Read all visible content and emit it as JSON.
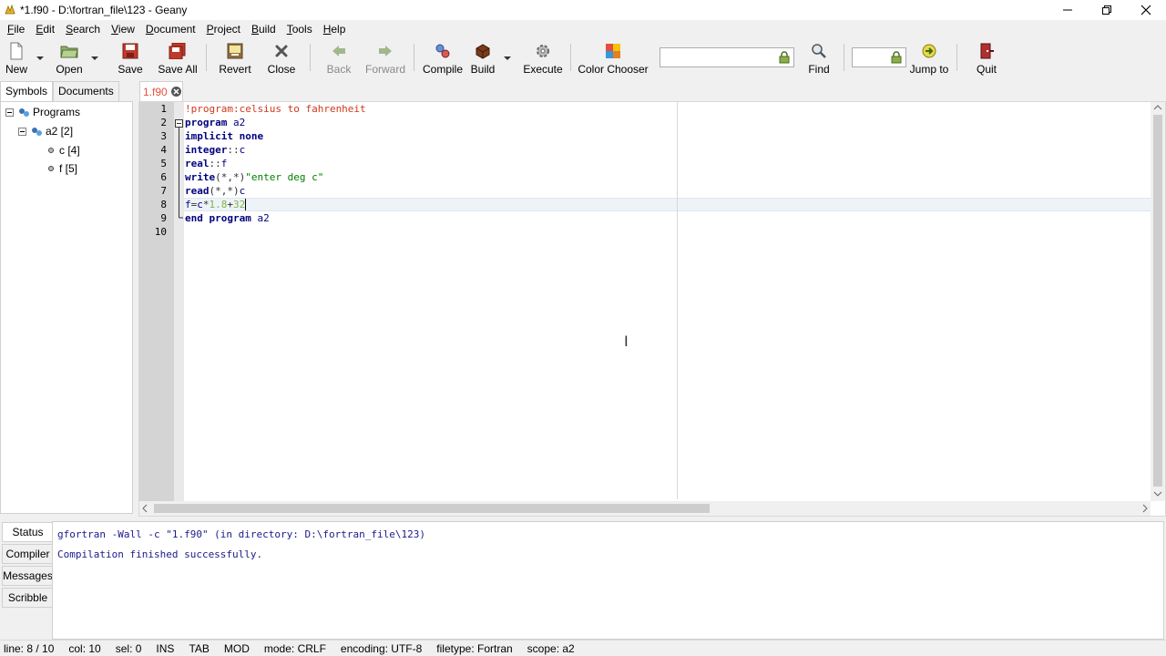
{
  "window": {
    "title": "*1.f90 - D:\\fortran_file\\123 - Geany"
  },
  "menu": [
    "File",
    "Edit",
    "Search",
    "View",
    "Document",
    "Project",
    "Build",
    "Tools",
    "Help"
  ],
  "toolbar": {
    "new": "New",
    "open": "Open",
    "save": "Save",
    "save_all": "Save All",
    "revert": "Revert",
    "close": "Close",
    "back": "Back",
    "forward": "Forward",
    "compile": "Compile",
    "build": "Build",
    "execute": "Execute",
    "color_chooser": "Color Chooser",
    "search_value": "",
    "find": "Find",
    "line_value": "",
    "jump_to": "Jump to",
    "quit": "Quit"
  },
  "sidebar": {
    "tabs": [
      "Symbols",
      "Documents"
    ],
    "tree": {
      "root": "Programs",
      "program": "a2 [2]",
      "vars": [
        "c [4]",
        "f [5]"
      ]
    }
  },
  "editor": {
    "tab_name": "1.f90",
    "line_numbers": [
      "1",
      "2",
      "3",
      "4",
      "5",
      "6",
      "7",
      "8",
      "9",
      "10"
    ],
    "current_line": 8
  },
  "messages": {
    "tabs": [
      "Status",
      "Compiler",
      "Messages",
      "Scribble"
    ],
    "lines": [
      "gfortran -Wall -c \"1.f90\" (in directory: D:\\fortran_file\\123)",
      "Compilation finished successfully."
    ]
  },
  "status": {
    "line": "line: 8 / 10",
    "col": "col: 10",
    "sel": "sel: 0",
    "ins": "INS",
    "tab": "TAB",
    "mod": "MOD",
    "mode": "mode: CRLF",
    "encoding": "encoding: UTF-8",
    "filetype": "filetype: Fortran",
    "scope": "scope: a2"
  },
  "colors": {
    "comment": "#d0381c",
    "keyword": "#00007f",
    "string": "#008000",
    "number": "#7fb347",
    "operator": "#303030",
    "tab_text": "#e8513a",
    "message_text": "#1a1a8c"
  }
}
